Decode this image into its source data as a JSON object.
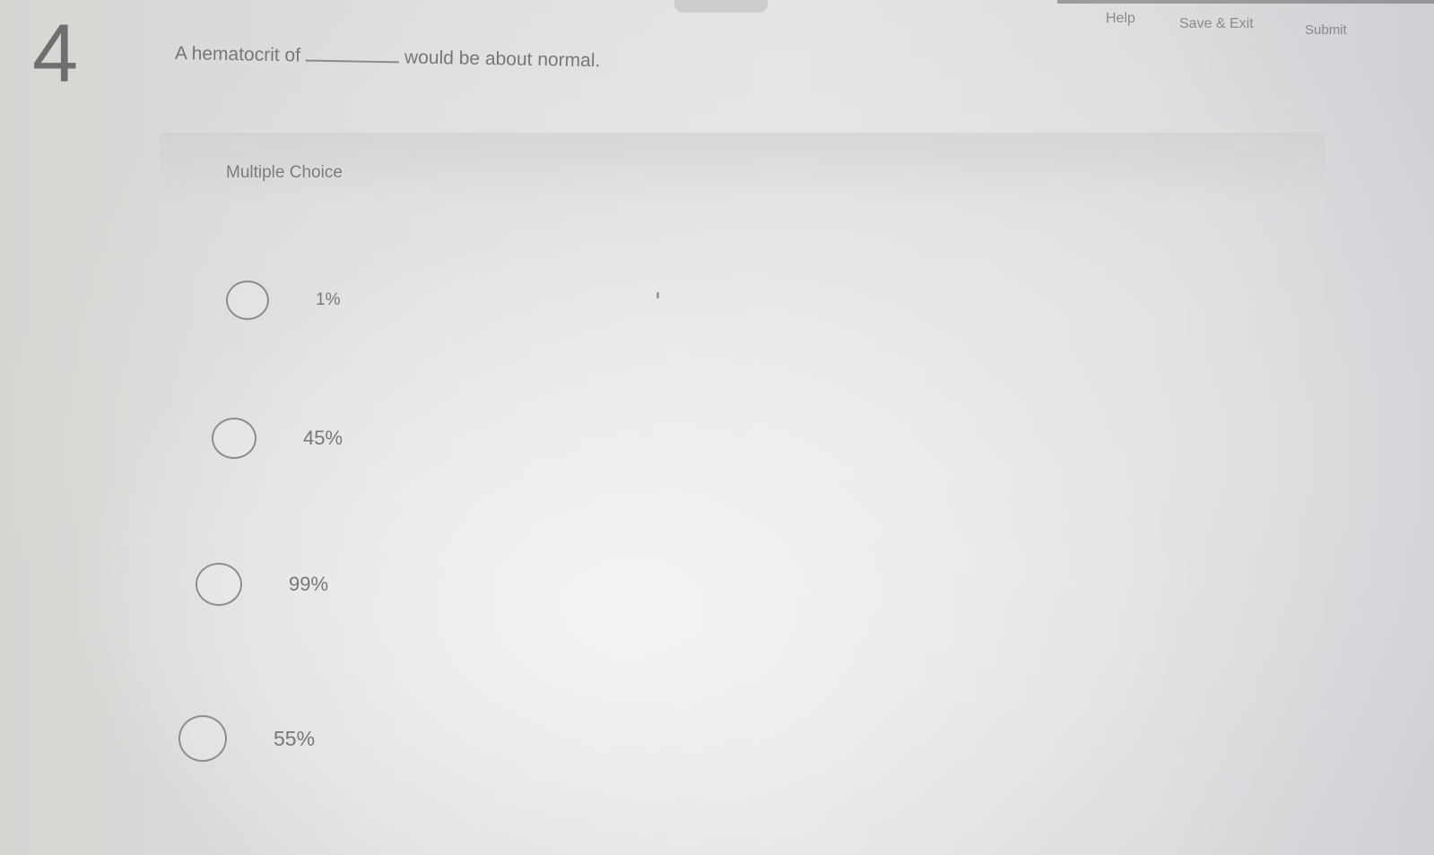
{
  "header": {
    "help_label": "Help",
    "save_exit_label": "Save & Exit",
    "submit_label": "Submit"
  },
  "question": {
    "number": "4",
    "text_before": "A hematocrit of",
    "text_after": "would be about normal."
  },
  "answer_type": "Multiple Choice",
  "options": [
    {
      "label": "1%"
    },
    {
      "label": "45%"
    },
    {
      "label": "99%"
    },
    {
      "label": "55%"
    }
  ]
}
